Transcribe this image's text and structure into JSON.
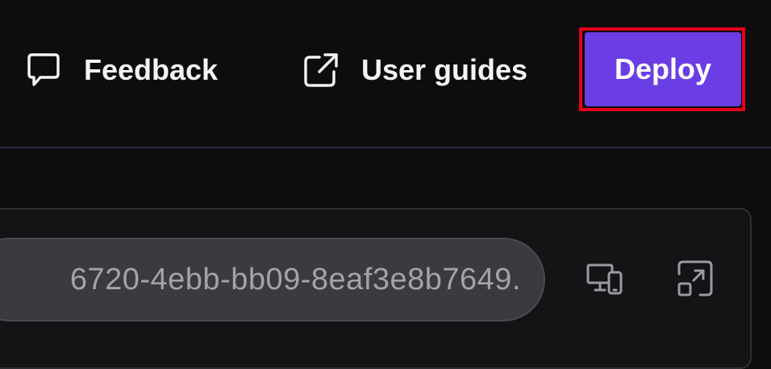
{
  "header": {
    "feedback_label": "Feedback",
    "feedback_icon": "message-square-icon",
    "guides_label": "User guides",
    "guides_icon": "external-link-icon",
    "deploy_label": "Deploy"
  },
  "preview": {
    "url_text": "6720-4ebb-bb09-8eaf3e8b7649.",
    "devices_icon": "devices-icon",
    "expand_icon": "expand-icon"
  },
  "colors": {
    "background": "#0d0d0e",
    "accent": "#6a3ee4",
    "highlight": "#e6001c"
  }
}
